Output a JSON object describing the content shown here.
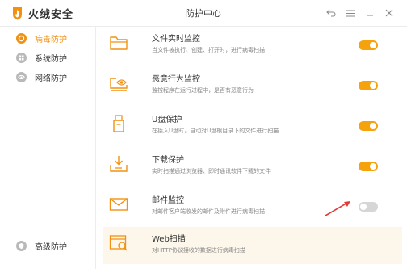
{
  "app": {
    "name": "火绒安全",
    "window_title": "防护中心",
    "accent_color": "#f29111"
  },
  "window_controls": [
    {
      "name": "back-icon"
    },
    {
      "name": "menu-icon"
    },
    {
      "name": "minimize-icon"
    },
    {
      "name": "close-icon"
    }
  ],
  "sidebar": {
    "items": [
      {
        "label": "病毒防护",
        "icon": "virus-shield-icon",
        "active": true
      },
      {
        "label": "系统防护",
        "icon": "windows-icon",
        "active": false
      },
      {
        "label": "网络防护",
        "icon": "globe-icon",
        "active": false
      }
    ],
    "bottom_item": {
      "label": "高级防护",
      "icon": "advanced-shield-icon"
    }
  },
  "features": [
    {
      "title": "文件实时监控",
      "desc": "当文件被执行、创建、打开时，进行病毒扫描",
      "icon": "folder-icon",
      "enabled": true
    },
    {
      "title": "恶意行为监控",
      "desc": "监控程序在运行过程中，是否有恶意行为",
      "icon": "monitor-eye-icon",
      "enabled": true
    },
    {
      "title": "U盘保护",
      "desc": "在接入U盘时，自动对U盘根目录下的文件进行扫描",
      "icon": "usb-drive-icon",
      "enabled": true
    },
    {
      "title": "下载保护",
      "desc": "实时扫描通过浏览器、即时通讯软件下载的文件",
      "icon": "download-tray-icon",
      "enabled": true
    },
    {
      "title": "邮件监控",
      "desc": "对邮件客户端收发的邮件及附件进行病毒扫描",
      "icon": "mail-icon",
      "enabled": false
    },
    {
      "title": "Web扫描",
      "desc": "对HTTP协议接收的数据进行病毒扫描",
      "icon": "web-scan-icon"
    }
  ]
}
